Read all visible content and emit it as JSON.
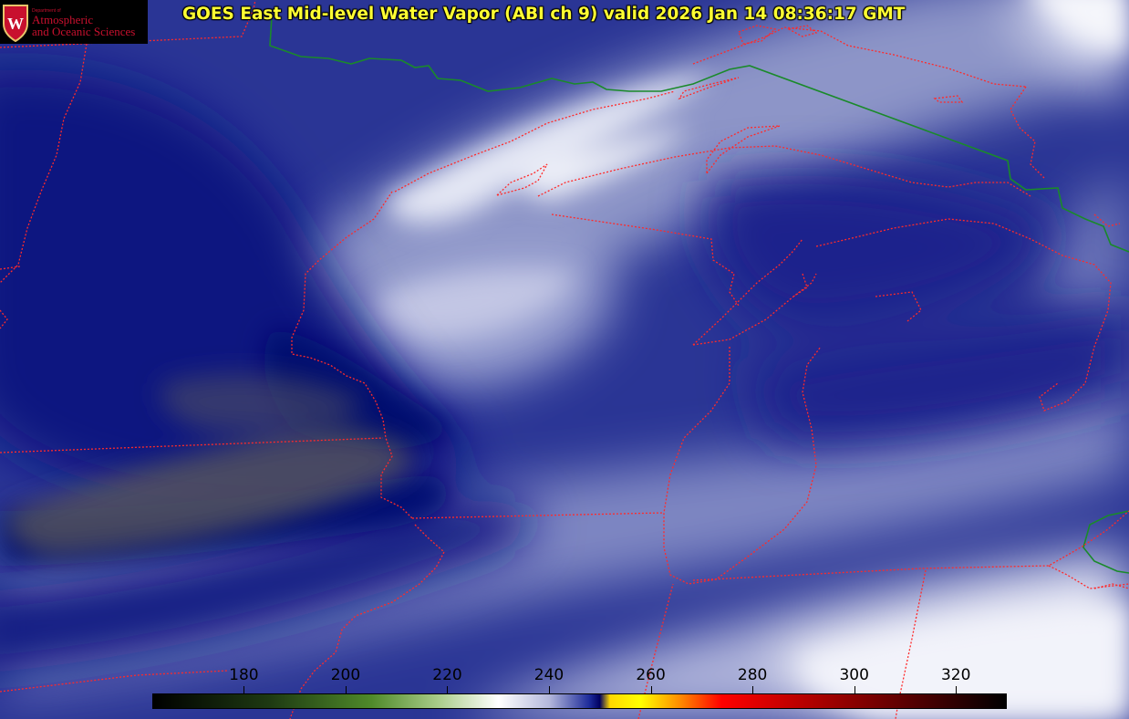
{
  "title": "GOES East Mid-level Water Vapor (ABI ch 9)  valid 2026 Jan 14 08:36:17 GMT",
  "logo": {
    "small_text": "Department of",
    "line1": "Atmospheric",
    "line2": "and Oceanic Sciences",
    "seal_letter": "W"
  },
  "colorbar": {
    "ticks": [
      "180",
      "200",
      "220",
      "240",
      "260",
      "280",
      "300",
      "320"
    ],
    "range": [
      162,
      330
    ],
    "stops": [
      {
        "value": 162,
        "color": "#000000"
      },
      {
        "value": 185,
        "color": "#1e3a12"
      },
      {
        "value": 205,
        "color": "#4f8a2a"
      },
      {
        "value": 218,
        "color": "#a8cc88"
      },
      {
        "value": 230,
        "color": "#ffffff"
      },
      {
        "value": 240,
        "color": "#b4b8dc"
      },
      {
        "value": 248,
        "color": "#1c2a9a"
      },
      {
        "value": 250,
        "color": "#000060"
      },
      {
        "value": 252,
        "color": "#ffd800"
      },
      {
        "value": 258,
        "color": "#ffff00"
      },
      {
        "value": 266,
        "color": "#ff8800"
      },
      {
        "value": 274,
        "color": "#ff0000"
      },
      {
        "value": 300,
        "color": "#8a0000"
      },
      {
        "value": 330,
        "color": "#000000"
      }
    ]
  },
  "colors": {
    "title_text": "#ffff33",
    "state_border": "#ff2a2a",
    "country_border": "#1a8a2a",
    "water_vapor_dry": "#050d7a",
    "water_vapor_moist": "#f0f2fa"
  }
}
